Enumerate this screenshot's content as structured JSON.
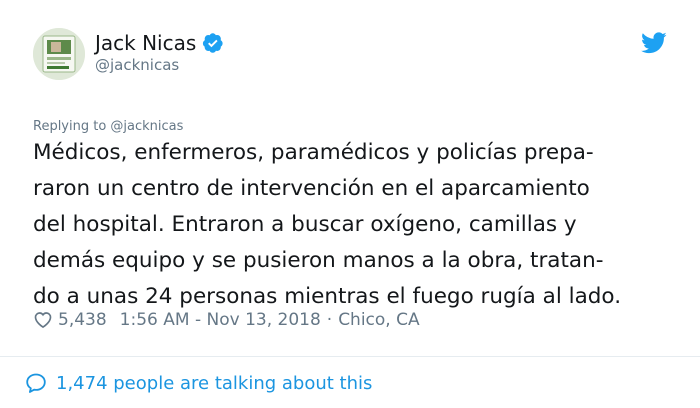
{
  "author": {
    "name": "Jack Nicas",
    "handle": "@jacknicas",
    "verified": true
  },
  "tweet": {
    "reply_to": "Replying to @jacknicas",
    "lines": [
      "Médicos, enfermeros, paramédicos y policías prepa-",
      "raron un centro de intervención en el aparcamiento",
      "del hospital. Entraron a buscar oxígeno, camillas y",
      "demás equipo y se pusieron manos a la obra, tratan-",
      "do a unas 24 personas mientras el fuego rugía al lado."
    ],
    "likes": "5,438",
    "timestamp": "1:56 AM - Nov 13, 2018",
    "separator": "·",
    "location": "Chico, CA"
  },
  "footer": {
    "talking": "1,474 people are talking about this"
  },
  "icons": {
    "brand": "twitter-bird-icon",
    "verified": "verified-badge-icon",
    "like": "heart-icon",
    "reply": "speech-bubble-icon"
  },
  "colors": {
    "brand_blue": "#1da1f2",
    "link_blue": "#1b95e0",
    "muted_gray": "#657786",
    "text": "#14171a",
    "divider": "#e6ecf0"
  }
}
